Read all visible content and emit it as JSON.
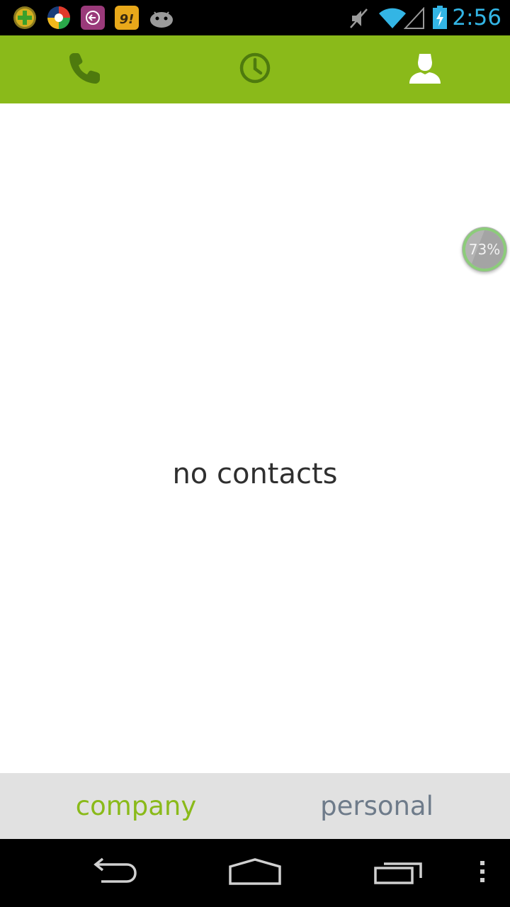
{
  "status_bar": {
    "time": "2:56",
    "notification_icons": [
      "add-app-icon",
      "colorful-ball-app-icon",
      "back-circle-app-icon",
      "yellow-app-icon",
      "android-robot-icon"
    ],
    "system_icons": [
      "muted-speaker-icon",
      "wifi-icon",
      "signal-icon",
      "battery-charging-icon"
    ]
  },
  "tabs": [
    {
      "name": "phone",
      "icon": "phone-icon",
      "selected": false
    },
    {
      "name": "recents",
      "icon": "clock-icon",
      "selected": false
    },
    {
      "name": "contacts",
      "icon": "person-icon",
      "selected": true
    }
  ],
  "main": {
    "empty_message": "no contacts"
  },
  "floating_badge": {
    "label": "73%",
    "value": 0.73
  },
  "segments": {
    "company": "company",
    "personal": "personal",
    "selected": "company"
  },
  "nav_bar": {
    "buttons": [
      "back-icon",
      "home-icon",
      "recent-apps-icon",
      "overflow-menu-icon"
    ]
  },
  "colors": {
    "accent": "#8aba1a",
    "tab_icon_inactive": "#4e7a0e",
    "tab_icon_active": "#ffffff",
    "clock": "#33b5e5",
    "segment_inactive": "#6e7b8a",
    "segment_bg": "#e1e1e1"
  }
}
